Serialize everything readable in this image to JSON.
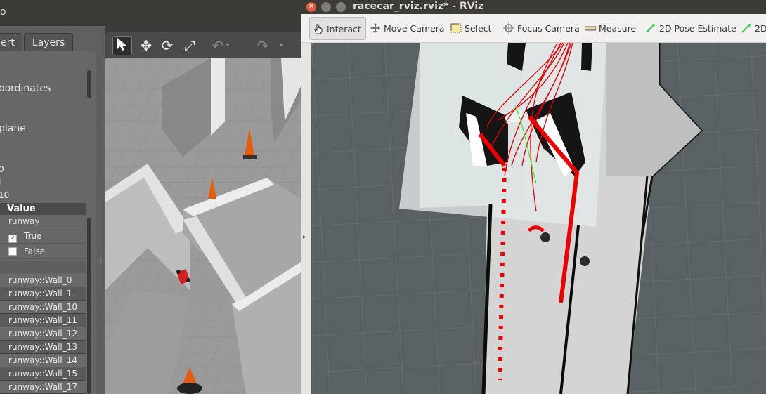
{
  "gazebo": {
    "title_fragment": "o",
    "tabs": [
      "ert",
      "Layers"
    ],
    "panel_labels": [
      "oordinates",
      "plane",
      "0",
      "l",
      "10"
    ],
    "table": {
      "header": "Value",
      "rows": [
        {
          "value": "runway"
        },
        {
          "value": "True",
          "checked": true
        },
        {
          "value": "False",
          "checked": false
        }
      ]
    },
    "models": [
      "runway::Wall_0",
      "runway::Wall_1",
      "runway::Wall_10",
      "runway::Wall_11",
      "runway::Wall_12",
      "runway::Wall_13",
      "runway::Wall_14",
      "runway::Wall_15",
      "runway::Wall_17"
    ],
    "toolbar_icons": [
      "select-arrow-icon",
      "translate-icon",
      "rotate-icon",
      "scale-icon",
      "undo-icon",
      "redo-icon"
    ]
  },
  "rviz": {
    "title": "racecar_rviz.rviz* - RViz",
    "tools": [
      {
        "label": "Interact",
        "icon": "hand-icon",
        "active": true
      },
      {
        "label": "Move Camera",
        "icon": "move-camera-icon"
      },
      {
        "label": "Select",
        "icon": "select-box-icon"
      },
      {
        "label": "Focus Camera",
        "icon": "focus-camera-icon"
      },
      {
        "label": "Measure",
        "icon": "ruler-icon"
      },
      {
        "label": "2D Pose Estimate",
        "icon": "pose-arrow-icon"
      },
      {
        "label": "2D",
        "icon": "goal-arrow-icon"
      }
    ],
    "colors": {
      "grid_bg": "#5a6162",
      "path": "#ff0000",
      "plan": "#00ff00",
      "map_free": "#d9d9d9"
    }
  }
}
